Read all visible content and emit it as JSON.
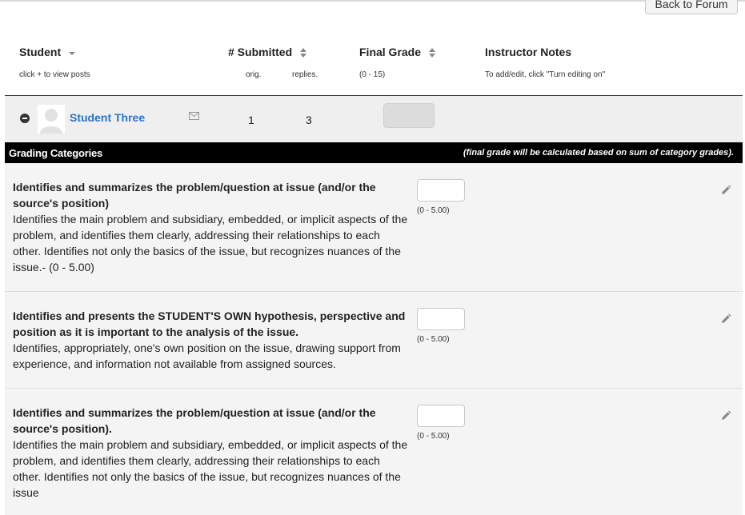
{
  "back_button": "Back to Forum",
  "columns": {
    "student": {
      "label": "Student",
      "sub": "click + to view posts"
    },
    "submitted": {
      "label": "# Submitted",
      "sub_orig": "orig.",
      "sub_replies": "replies."
    },
    "final_grade": {
      "label": "Final Grade",
      "sub": "(0 - 15)"
    },
    "notes": {
      "label": "Instructor Notes",
      "sub": "To add/edit, click \"Turn editing on\""
    }
  },
  "student_row": {
    "name": "Student Three",
    "orig": "1",
    "replies": "3"
  },
  "categories_bar": {
    "title": "Grading Categories",
    "note": "(final grade will be calculated based on sum of category grades)."
  },
  "criteria": [
    {
      "title": "Identifies and summarizes the problem/question at issue (and/or the source's position)",
      "description": "Identifies the main problem and subsidiary, embedded, or implicit aspects of the problem, and identifies them clearly, addressing their relationships to each other. Identifies not only the basics of the issue, but recognizes nuances of the issue.- (0 - 5.00)",
      "range": "(0 - 5.00)"
    },
    {
      "title": "Identifies and presents the STUDENT'S OWN hypothesis, perspective and position as it is important to the analysis of the issue.",
      "description": "Identifies, appropriately, one's own position on the issue, drawing support from experience, and information not available from assigned sources.",
      "range": "(0 - 5.00)"
    },
    {
      "title": "Identifies and summarizes the problem/question at issue (and/or the source's position).",
      "description": "Identifies the main problem and subsidiary, embedded, or implicit aspects of the problem, and identifies them clearly, addressing their relationships to each other. Identifies not only the basics of the issue, but recognizes nuances of the issue",
      "range": "(0 - 5.00)"
    }
  ]
}
